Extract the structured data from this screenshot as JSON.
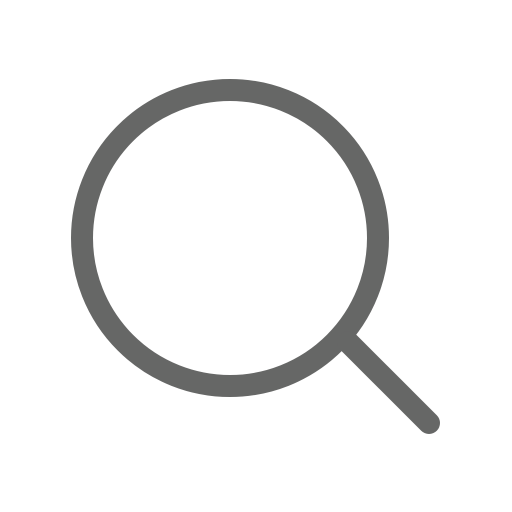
{
  "icon": {
    "name": "search-icon",
    "color": "#666766",
    "background": "#ffffff"
  }
}
